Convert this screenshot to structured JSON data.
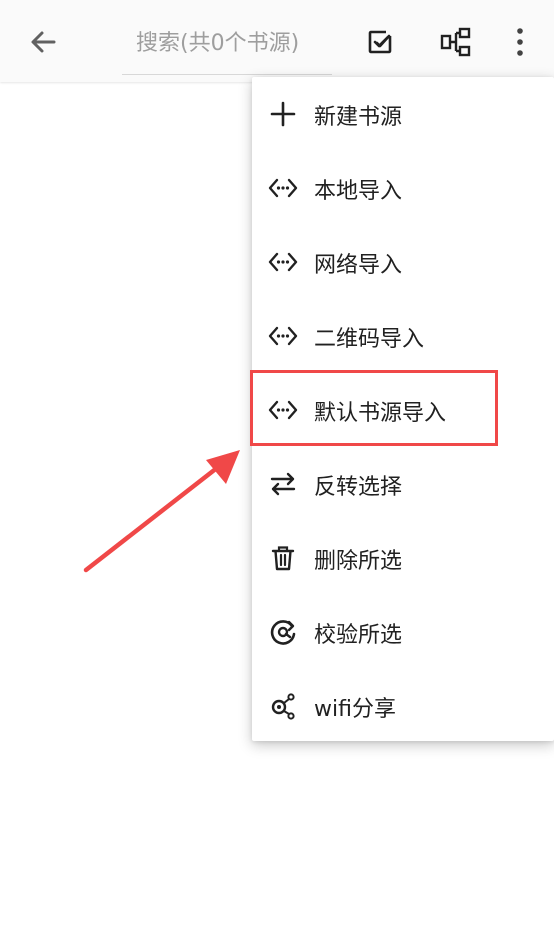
{
  "toolbar": {
    "search_placeholder": "搜索(共0个书源)",
    "icons": [
      "back-arrow-icon",
      "select-all-icon",
      "group-icon",
      "more-vert-icon"
    ]
  },
  "menu": {
    "items": [
      {
        "label": "新建书源",
        "icon": "plus-icon"
      },
      {
        "label": "本地导入",
        "icon": "code-import-icon"
      },
      {
        "label": "网络导入",
        "icon": "code-import-icon"
      },
      {
        "label": "二维码导入",
        "icon": "code-import-icon"
      },
      {
        "label": "默认书源导入",
        "icon": "code-import-icon"
      },
      {
        "label": "反转选择",
        "icon": "swap-icon"
      },
      {
        "label": "删除所选",
        "icon": "trash-icon"
      },
      {
        "label": "校验所选",
        "icon": "check-source-icon"
      },
      {
        "label": "wifi分享",
        "icon": "share-icon"
      }
    ]
  },
  "annotation": {
    "highlight_color": "#f04848",
    "highlighted_item": "默认书源导入"
  }
}
